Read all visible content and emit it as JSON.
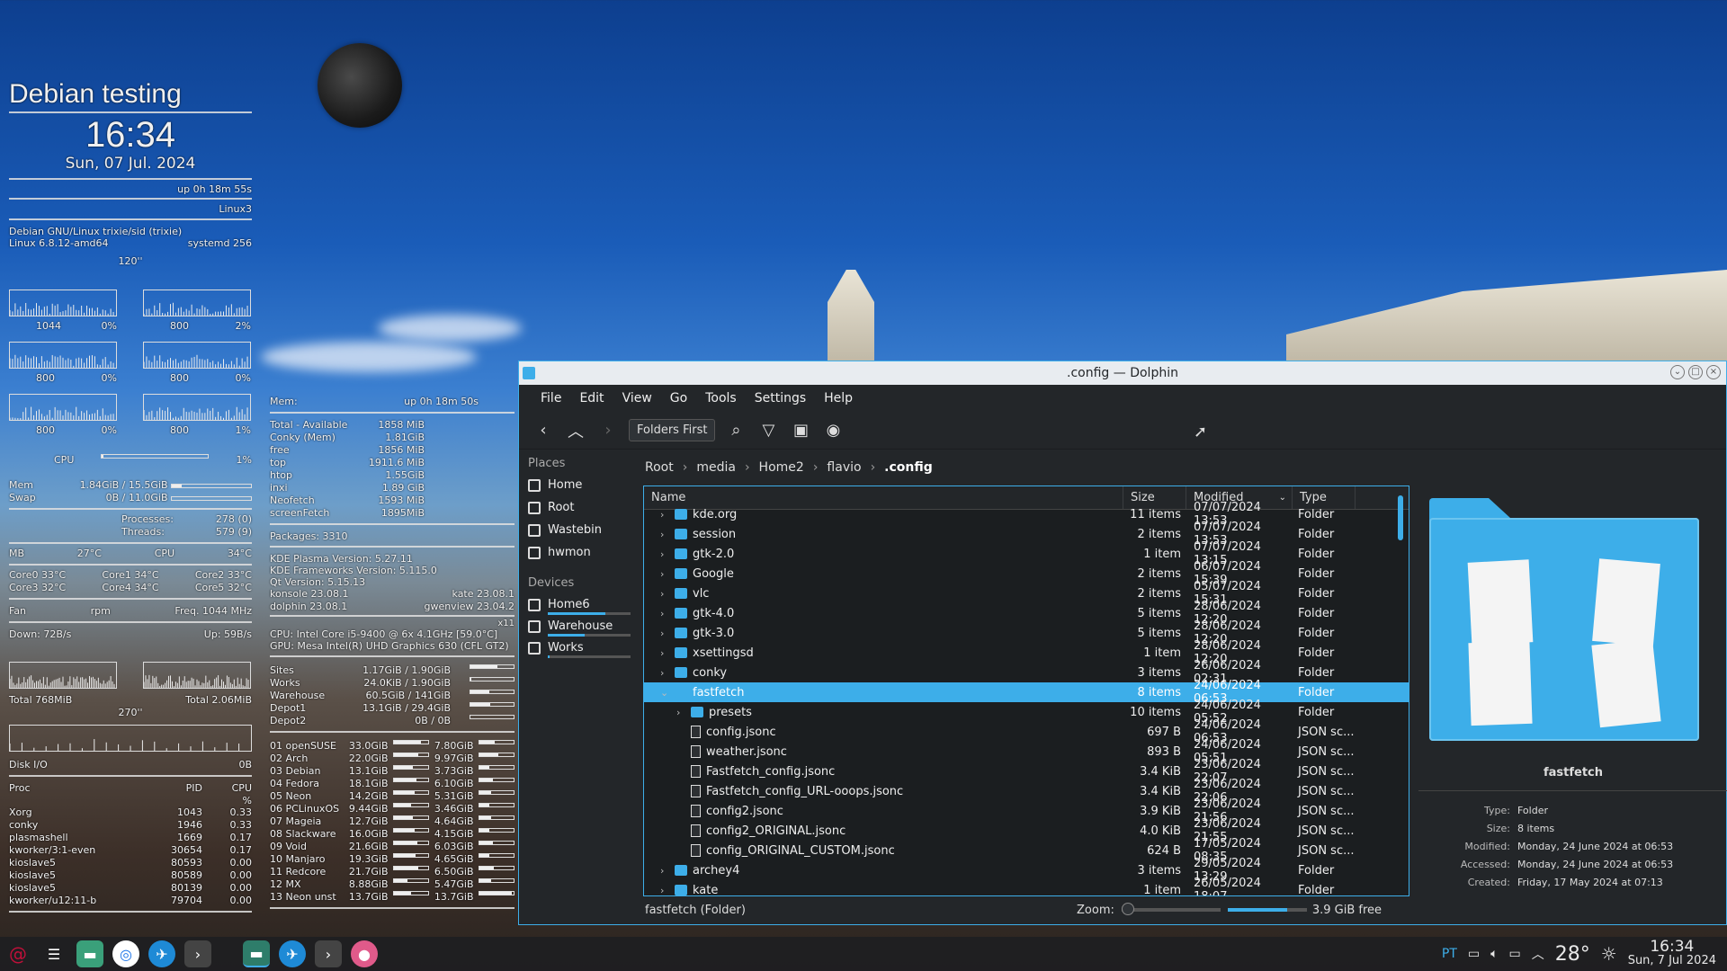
{
  "conky": {
    "distro": "Debian testing",
    "time": "16:34",
    "date": "Sun, 07 Jul. 2024",
    "uptime": "up  0h 18m 55s",
    "host": "Linux3",
    "os": "Debian GNU/Linux trixie/sid (trixie)",
    "kernel": "Linux 6.8.12-amd64",
    "systemd": "systemd 256",
    "cpu_graph_label": "120''",
    "cpu_cores": [
      [
        "1044",
        "0%"
      ],
      [
        "800",
        "2%"
      ],
      [
        "800",
        "0%"
      ],
      [
        "800",
        "0%"
      ],
      [
        "800",
        "0%"
      ],
      [
        "800",
        "1%"
      ]
    ],
    "cpu_total_label": "CPU",
    "cpu_total": "1%",
    "cpu_total_level": 0.01,
    "mem_label": "Mem",
    "mem": "1.84GiB / 15.5GiB",
    "mem_level": 0.12,
    "swap_label": "Swap",
    "swap": "0B / 11.0GiB",
    "swap_level": 0.0,
    "proc_label": "Processes:",
    "proc": "278 (0)",
    "threads_label": "Threads:",
    "threads": "579 (9)",
    "mb_label": "MB",
    "mb_temp": "27°C",
    "cpu_label": "CPU",
    "cpu_temp": "34°C",
    "core0": "Core0  33°C",
    "core1": "Core1  34°C",
    "core2": "Core2  33°C",
    "core3": "Core3  32°C",
    "core4": "Core4  34°C",
    "core5": "Core5  32°C",
    "fan": "Fan",
    "rpm": "rpm",
    "freq": "Freq.  1044   MHz",
    "down": "Down: 72B/s",
    "up": "Up: 59B/s",
    "total_down": "Total 768MiB",
    "total_up": "Total 2.06MiB",
    "net_graph_label": "270''",
    "disk_io": "Disk I/O",
    "disk_io_val": "0B",
    "proc_header": [
      "Proc",
      "PID",
      "CPU"
    ],
    "proc_unit": "%",
    "procs": [
      [
        "Xorg",
        "1043",
        "0.33"
      ],
      [
        "conky",
        "1946",
        "0.33"
      ],
      [
        "plasmashell",
        "1669",
        "0.17"
      ],
      [
        "kworker/3:1-even",
        "30654",
        "0.17"
      ],
      [
        "kioslave5",
        "80593",
        "0.00"
      ],
      [
        "kioslave5",
        "80589",
        "0.00"
      ],
      [
        "kioslave5",
        "80139",
        "0.00"
      ],
      [
        "kworker/u12:11-b",
        "79704",
        "0.00"
      ]
    ],
    "mem2_label": "Mem:",
    "mem2_uptime": "up  0h 18m 50s",
    "mem_rows": [
      [
        "Total - Available",
        "1858 MiB"
      ],
      [
        "Conky (Mem)",
        "1.81GiB"
      ],
      [
        "free",
        "1856  MiB"
      ],
      [
        "top",
        "1911.6  MiB"
      ],
      [
        "htop",
        "1.55GiB"
      ],
      [
        "inxi",
        "1.89 GiB"
      ],
      [
        "Neofetch",
        "1593 MiB"
      ],
      [
        "screenFetch",
        "1895MiB"
      ]
    ],
    "packages": "Packages: 3310",
    "versions": [
      "KDE Plasma Version: 5.27.11",
      "KDE Frameworks Version: 5.115.0",
      "Qt Version: 5.15.13"
    ],
    "konsole": "konsole 23.08.1",
    "kate": "kate 23.08.1",
    "dolphin_ver": "dolphin 23.08.1",
    "gwenview": "gwenview 23.04.2",
    "x11": "x11",
    "cpu_model": "CPU: Intel Core i5-9400 @ 6x 4.1GHz [59.0°C]",
    "gpu": "GPU: Mesa Intel(R) UHD Graphics 630 (CFL GT2)",
    "drives": [
      [
        "Sites",
        "1.17GiB / 1.90GiB",
        0.62
      ],
      [
        "Works",
        "24.0KiB / 1.90GiB",
        0.01
      ],
      [
        "Warehouse",
        "60.5GiB / 141GiB",
        0.43
      ],
      [
        "Depot1",
        "13.1GiB / 29.4GiB",
        0.45
      ],
      [
        "Depot2",
        "0B / 0B",
        0.0
      ]
    ],
    "parts": [
      [
        "01 openSUSE",
        "33.0GiB",
        "7.80GiB",
        0.8,
        0.45
      ],
      [
        "02 Arch",
        "22.0GiB",
        "9.97GiB",
        0.7,
        0.55
      ],
      [
        "03 Debian",
        "13.1GiB",
        "3.73GiB",
        0.55,
        0.3
      ],
      [
        "04 Fedora",
        "18.1GiB",
        "6.10GiB",
        0.65,
        0.4
      ],
      [
        "05 Neon",
        "14.2GiB",
        "5.31GiB",
        0.6,
        0.35
      ],
      [
        "06 PCLinuxOS",
        "9.44GiB",
        "3.46GiB",
        0.5,
        0.3
      ],
      [
        "07 Mageia",
        "12.7GiB",
        "4.64GiB",
        0.55,
        0.35
      ],
      [
        "08 Slackware",
        "16.0GiB",
        "4.15GiB",
        0.6,
        0.3
      ],
      [
        "09 Void",
        "21.6GiB",
        "6.03GiB",
        0.68,
        0.4
      ],
      [
        "10 Manjaro",
        "19.3GiB",
        "4.65GiB",
        0.64,
        0.3
      ],
      [
        "11 Redcore",
        "21.7GiB",
        "6.50GiB",
        0.7,
        0.42
      ],
      [
        "12 MX",
        "8.88GiB",
        "5.47GiB",
        0.4,
        0.35
      ],
      [
        "13 Neon unst",
        "13.7GiB",
        "13.7GiB",
        0.5,
        0.95
      ]
    ]
  },
  "dolphin": {
    "title": ".config — Dolphin",
    "menu": [
      "File",
      "Edit",
      "View",
      "Go",
      "Tools",
      "Settings",
      "Help"
    ],
    "toolbar_sort": "Folders First",
    "places_header": "Places",
    "places": [
      "Home",
      "Root",
      "Wastebin",
      "hwmon"
    ],
    "devices_header": "Devices",
    "devices": [
      [
        "Home6",
        0.7
      ],
      [
        "Warehouse",
        0.45
      ],
      [
        "Works",
        0.02
      ]
    ],
    "crumbs": [
      "Root",
      "media",
      "Home2",
      "flavio"
    ],
    "crumb_current": ".config",
    "columns": [
      "Name",
      "Size",
      "Modified",
      "Type"
    ],
    "rows": [
      [
        "kde.org",
        "11 items",
        "07/07/2024 13:53",
        "Folder",
        0,
        "folder",
        false,
        "collapsed"
      ],
      [
        "session",
        "2 items",
        "07/07/2024 13:53",
        "Folder",
        0,
        "folder",
        false,
        "collapsed"
      ],
      [
        "gtk-2.0",
        "1 item",
        "07/07/2024 13:15",
        "Folder",
        0,
        "folder",
        false,
        "collapsed"
      ],
      [
        "Google",
        "2 items",
        "06/07/2024 15:39",
        "Folder",
        0,
        "folder",
        false,
        "collapsed"
      ],
      [
        "vlc",
        "2 items",
        "05/07/2024 15:31",
        "Folder",
        0,
        "folder",
        false,
        "collapsed"
      ],
      [
        "gtk-4.0",
        "5 items",
        "28/06/2024 12:20",
        "Folder",
        0,
        "folder",
        false,
        "collapsed"
      ],
      [
        "gtk-3.0",
        "5 items",
        "28/06/2024 12:20",
        "Folder",
        0,
        "folder",
        false,
        "collapsed"
      ],
      [
        "xsettingsd",
        "1 item",
        "28/06/2024 12:20",
        "Folder",
        0,
        "folder",
        false,
        "collapsed"
      ],
      [
        "conky",
        "3 items",
        "26/06/2024 02:31",
        "Folder",
        0,
        "folder",
        false,
        "collapsed"
      ],
      [
        "fastfetch",
        "8 items",
        "24/06/2024 06:53",
        "Folder",
        0,
        "folder",
        true,
        "expanded"
      ],
      [
        "presets",
        "10 items",
        "24/06/2024 05:52",
        "Folder",
        1,
        "folder",
        false,
        "collapsed"
      ],
      [
        "config.jsonc",
        "697 B",
        "24/06/2024 06:53",
        "JSON sc...",
        1,
        "file",
        false,
        "none"
      ],
      [
        "weather.jsonc",
        "893 B",
        "24/06/2024 05:51",
        "JSON sc...",
        1,
        "file",
        false,
        "none"
      ],
      [
        "Fastfetch_config.jsonc",
        "3.4 KiB",
        "23/06/2024 22:07",
        "JSON sc...",
        1,
        "file",
        false,
        "none"
      ],
      [
        "Fastfetch_config_URL-ooops.jsonc",
        "3.4 KiB",
        "23/06/2024 22:06",
        "JSON sc...",
        1,
        "file",
        false,
        "none"
      ],
      [
        "config2.jsonc",
        "3.9 KiB",
        "23/06/2024 21:56",
        "JSON sc...",
        1,
        "file",
        false,
        "none"
      ],
      [
        "config2_ORIGINAL.jsonc",
        "4.0 KiB",
        "23/06/2024 21:55",
        "JSON sc...",
        1,
        "file",
        false,
        "none"
      ],
      [
        "config_ORIGINAL_CUSTOM.jsonc",
        "624 B",
        "17/05/2024 08:35",
        "JSON sc...",
        1,
        "file",
        false,
        "none"
      ],
      [
        "archey4",
        "3 items",
        "29/05/2024 13:29",
        "Folder",
        0,
        "folder",
        false,
        "collapsed"
      ],
      [
        "kate",
        "1 item",
        "26/05/2024 18:07",
        "Folder",
        0,
        "folder",
        false,
        "collapsed"
      ]
    ],
    "info": {
      "name": "fastfetch",
      "fields": [
        [
          "Type:",
          "Folder"
        ],
        [
          "Size:",
          "8 items"
        ],
        [
          "Modified:",
          "Monday, 24 June 2024 at 06:53"
        ],
        [
          "Accessed:",
          "Monday, 24 June 2024 at 06:53"
        ],
        [
          "Created:",
          "Friday, 17 May 2024 at 07:13"
        ]
      ]
    },
    "status": "fastfetch (Folder)",
    "zoom_label": "Zoom:",
    "zoom_level": 0.0,
    "free": "3.9 GiB free",
    "free_level": 0.75
  },
  "taskbar": {
    "lang": "PT",
    "temp": "28°",
    "clock": "16:34",
    "date": "Sun, 7 Jul 2024"
  }
}
